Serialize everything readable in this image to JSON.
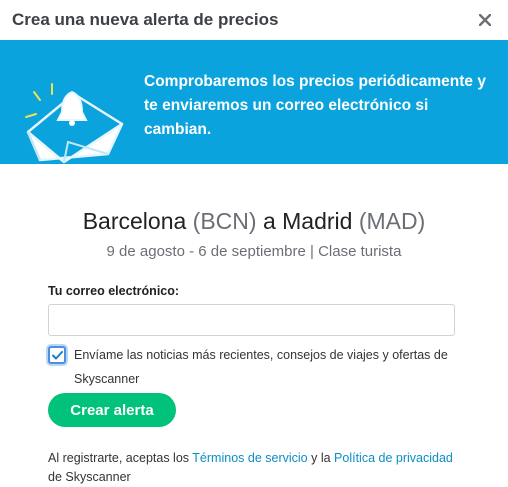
{
  "dialog": {
    "title": "Crea una nueva alerta de precios",
    "close_glyph": "✕"
  },
  "banner": {
    "message": "Comprobaremos los precios periódicamente y te enviaremos un correo electrónico si cambian.",
    "icon": "envelope-bell-icon",
    "bg_color": "#0aa3dd"
  },
  "route": {
    "origin_city": "Barcelona",
    "origin_code": "(BCN)",
    "connector": "a",
    "destination_city": "Madrid",
    "destination_code": "(MAD)",
    "details": "9 de agosto - 6 de septiembre | Clase turista"
  },
  "form": {
    "email_label": "Tu correo electrónico:",
    "email_value": "",
    "newsletter_checked": true,
    "newsletter_text": "Envíame las noticias más recientes, consejos de viajes y ofertas de Skyscanner",
    "submit_label": "Crear alerta",
    "submit_color": "#00c27a"
  },
  "terms": {
    "prefix": "Al registrarte, aceptas los",
    "tos_link": "Términos de servicio",
    "middle": "y la",
    "privacy_link": "Política de privacidad",
    "suffix": "de Skyscanner",
    "link_color": "#0a8ec4"
  }
}
